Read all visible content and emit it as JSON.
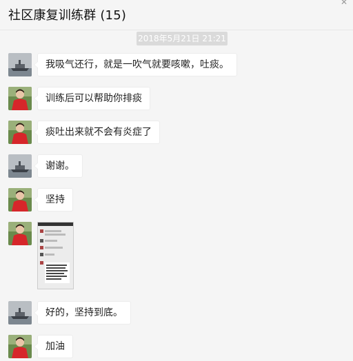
{
  "header": {
    "title": "社区康复训练群 (15)",
    "close_glyph": "✕"
  },
  "timestamp": "2018年5月21日 21:21",
  "avatars": {
    "ship": "ship-photo",
    "woman": "woman-in-red-photo"
  },
  "messages": [
    {
      "text": "我吸气还行，就是一吹气就要咳嗽，吐痰。",
      "avatar": "ship"
    },
    {
      "text": "训练后可以帮助你排痰",
      "avatar": "woman"
    },
    {
      "text": "痰吐出来就不会有炎症了",
      "avatar": "woman"
    },
    {
      "text": "谢谢。",
      "avatar": "ship"
    },
    {
      "text": "坚持",
      "avatar": "woman"
    },
    {
      "text": "",
      "avatar": "woman",
      "type": "image"
    },
    {
      "text": "好的，坚持到底。",
      "avatar": "ship"
    },
    {
      "text": "加油",
      "avatar": "woman"
    }
  ]
}
